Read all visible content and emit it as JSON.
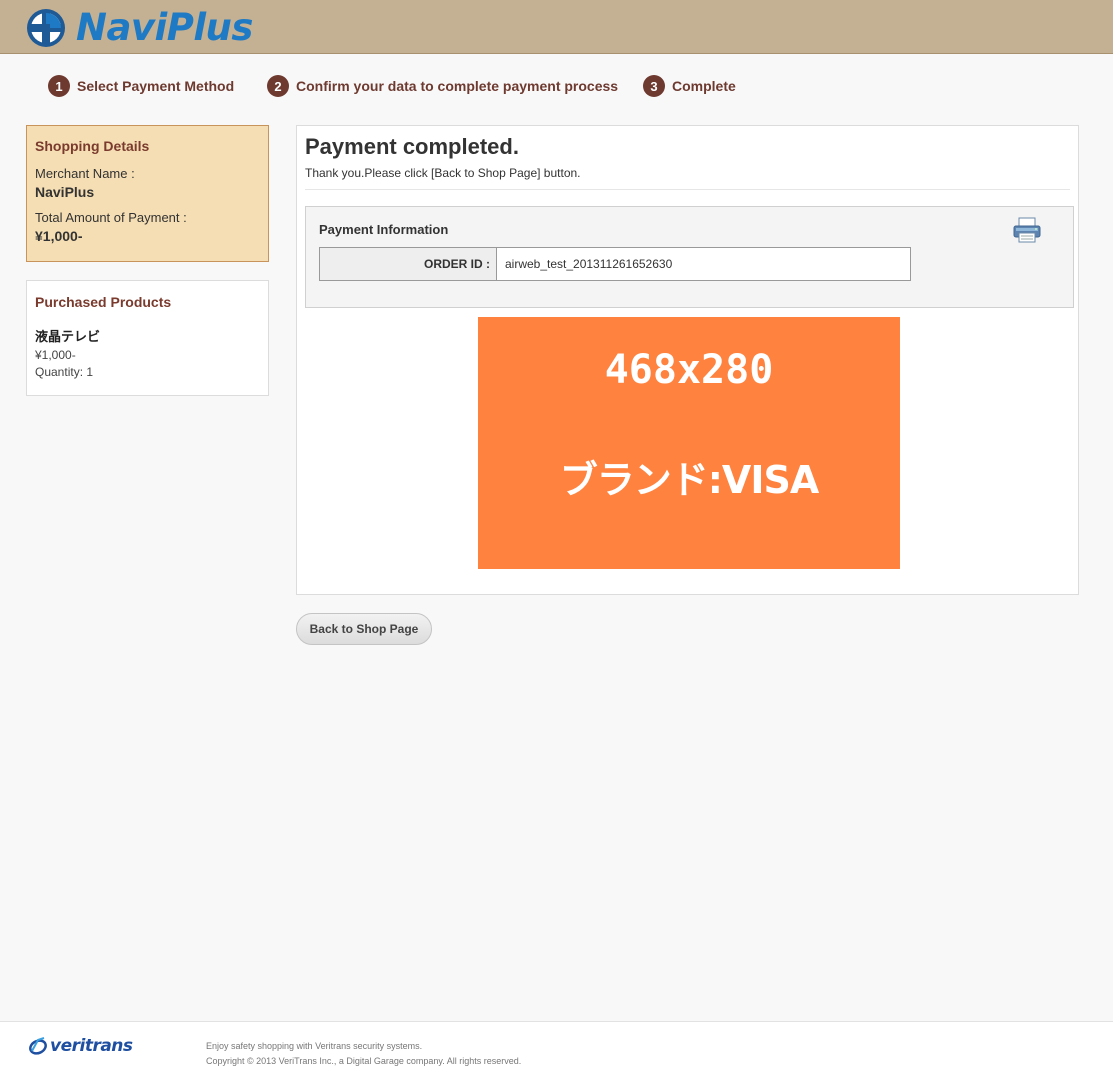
{
  "header": {
    "logo_text": "NaviPlus"
  },
  "steps": [
    {
      "num": "1",
      "label": "Select Payment Method"
    },
    {
      "num": "2",
      "label": "Confirm your data to complete payment process"
    },
    {
      "num": "3",
      "label": "Complete"
    }
  ],
  "shopping": {
    "title": "Shopping Details",
    "merchant_label": "Merchant Name :",
    "merchant_value": "NaviPlus",
    "amount_label": "Total Amount of Payment :",
    "amount_value": "¥1,000-"
  },
  "products": {
    "title": "Purchased Products",
    "items": [
      {
        "name": "液晶テレビ",
        "price": "¥1,000-",
        "quantity": "Quantity: 1"
      }
    ]
  },
  "main": {
    "title": "Payment completed.",
    "subtitle": "Thank you.Please click [Back to Shop Page] button.",
    "payment_info_title": "Payment Information",
    "order_label": "ORDER ID :",
    "order_value": "airweb_test_201311261652630",
    "banner_size": "468x280",
    "banner_brand": "ブランド:VISA"
  },
  "back_button": "Back to Shop Page",
  "footer": {
    "logo_text": "veritrans",
    "line1": "Enjoy safety shopping with Veritrans security systems.",
    "line2": "Copyright © 2013 VeriTrans Inc., a Digital Garage company. All rights reserved."
  },
  "colors": {
    "header_bg": "#c4b092",
    "step_accent": "#6e3a30",
    "brand_blue": "#1e7ac4",
    "banner_orange": "#ff823f",
    "shop_box_bg": "#f5deb3"
  },
  "icons": [
    "naviplus-logo-icon",
    "printer-icon",
    "veritrans-logo-icon"
  ]
}
